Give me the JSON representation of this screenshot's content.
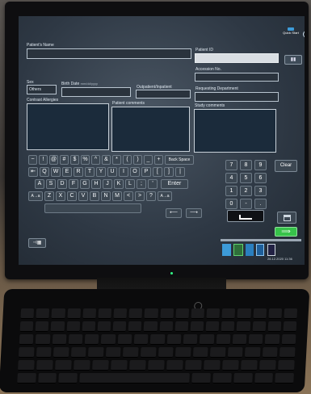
{
  "header": {
    "quick_label": "Quick Start",
    "help_label": "?"
  },
  "form": {
    "patient_name_label": "Patient's Name",
    "patient_id_label": "Patient ID",
    "accession_label": "Accession No.",
    "sex_label": "Sex",
    "sex_value": "Others",
    "birth_date_label": "Birth Date",
    "birth_date_hint": "mm/dd/yyyy",
    "outpatient_label": "Outpatient/Inpatient",
    "requesting_dept_label": "Requesting Department",
    "contrast_label": "Contrast Allergies",
    "patient_comments_label": "Patient comments",
    "study_comments_label": "Study comments"
  },
  "keyboard": {
    "row1": [
      "~",
      "!",
      "@",
      "#",
      "$",
      "%",
      "^",
      "&",
      "*",
      "(",
      ")",
      "_",
      "+",
      "Back Space"
    ],
    "row2": [
      "⇤",
      "Q",
      "W",
      "E",
      "R",
      "T",
      "Y",
      "U",
      "I",
      "O",
      "P",
      "[",
      "]",
      "|"
    ],
    "row3": [
      "A",
      "S",
      "D",
      "F",
      "G",
      "H",
      "J",
      "K",
      "L",
      ";",
      "'"
    ],
    "row3_enter": "Enter",
    "row4": [
      "A→a",
      "Z",
      "X",
      "C",
      "V",
      "B",
      "N",
      "M",
      "<",
      ">",
      "?",
      "A→a"
    ],
    "arrow_left": "⟵",
    "arrow_right": "⟶",
    "numpad": [
      "7",
      "8",
      "9",
      "4",
      "5",
      "6",
      "1",
      "2",
      "3",
      "0",
      "-",
      "."
    ],
    "clear_label": "Clear",
    "go_label": "⟹",
    "toggle_label": "⊣▦"
  },
  "status": {
    "clock": "26.12.2020 11:36"
  },
  "colors": {
    "screen": "#2e3844",
    "accent_green": "#37c24a",
    "accent_blue": "#3d9bd8"
  }
}
